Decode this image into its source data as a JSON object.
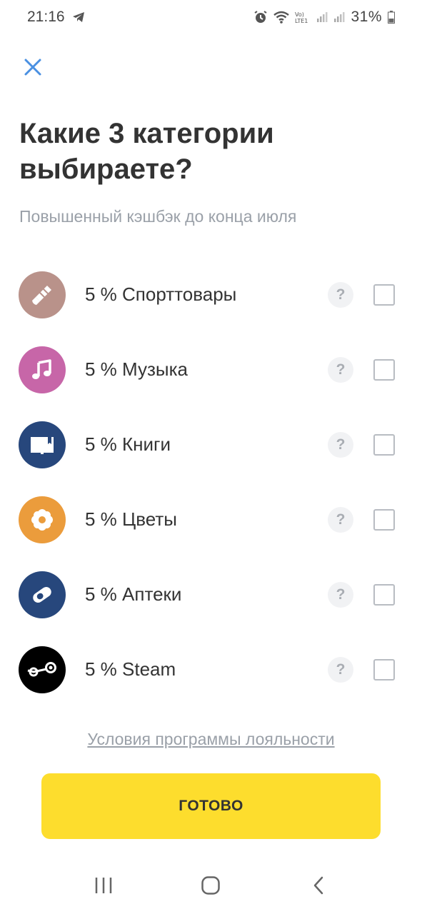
{
  "status_bar": {
    "time": "21:16",
    "battery_percent": "31%",
    "network_label": "Vo) LTE1"
  },
  "header": {
    "title": "Какие 3 категории выбираете?",
    "subtitle": "Повышенный кэшбэк до конца июля"
  },
  "categories": [
    {
      "label": "5 % Спорттовары",
      "icon": "shuttlecock-icon",
      "color": "#b9928a",
      "checked": false
    },
    {
      "label": "5 % Музыка",
      "icon": "music-note-icon",
      "color": "#c766a8",
      "checked": false
    },
    {
      "label": "5 % Книги",
      "icon": "book-icon",
      "color": "#27477c",
      "checked": false
    },
    {
      "label": "5 % Цветы",
      "icon": "flower-icon",
      "color": "#eb9c3c",
      "checked": false
    },
    {
      "label": "5 % Аптеки",
      "icon": "pill-icon",
      "color": "#27477c",
      "checked": false
    },
    {
      "label": "5 % Steam",
      "icon": "steam-icon",
      "color": "#000000",
      "checked": false
    }
  ],
  "help_label": "?",
  "footer": {
    "terms_link": "Условия программы лояльности",
    "done_button": "ГОТОВО"
  },
  "colors": {
    "accent_yellow": "#fddd2d",
    "close_blue": "#4a90e2",
    "muted_text": "#9aa0a8"
  }
}
